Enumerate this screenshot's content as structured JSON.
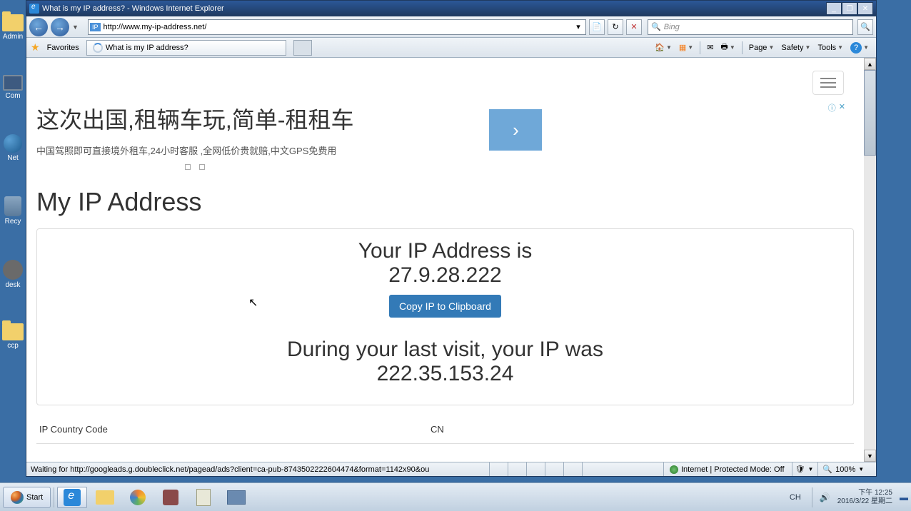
{
  "desktop": {
    "icons": [
      "Admin",
      "Com",
      "Net",
      "Recy",
      "desk",
      "ccp"
    ]
  },
  "window": {
    "title": "What is my IP address? - Windows Internet Explorer",
    "url": "http://www.my-ip-address.net/",
    "search_placeholder": "Bing",
    "favorites_label": "Favorites",
    "tab_title": "What is my IP address?",
    "menu": {
      "page": "Page",
      "safety": "Safety",
      "tools": "Tools"
    }
  },
  "page": {
    "ad": {
      "title": "这次出国,租辆车玩,简单-租租车",
      "subtitle": "中国驾照即可直接境外租车,24小时客服 ,全网低价贵就赔,中文GPS免费用"
    },
    "heading": "My IP Address",
    "ip_label": "Your IP Address is",
    "ip_value": "27.9.28.222",
    "copy_btn": "Copy IP to Clipboard",
    "last_label": "During your last visit, your IP was",
    "last_ip": "222.35.153.24",
    "row_key": "IP Country Code",
    "row_val": "CN"
  },
  "statusbar": {
    "text": "Waiting for http://googleads.g.doubleclick.net/pagead/ads?client=ca-pub-8743502222604474&format=1142x90&ou",
    "zone": "Internet | Protected Mode: Off",
    "zoom": "100%"
  },
  "taskbar": {
    "start": "Start",
    "lang": "CH",
    "time": "下午 12:25",
    "date": "2016/3/22 星期二"
  }
}
